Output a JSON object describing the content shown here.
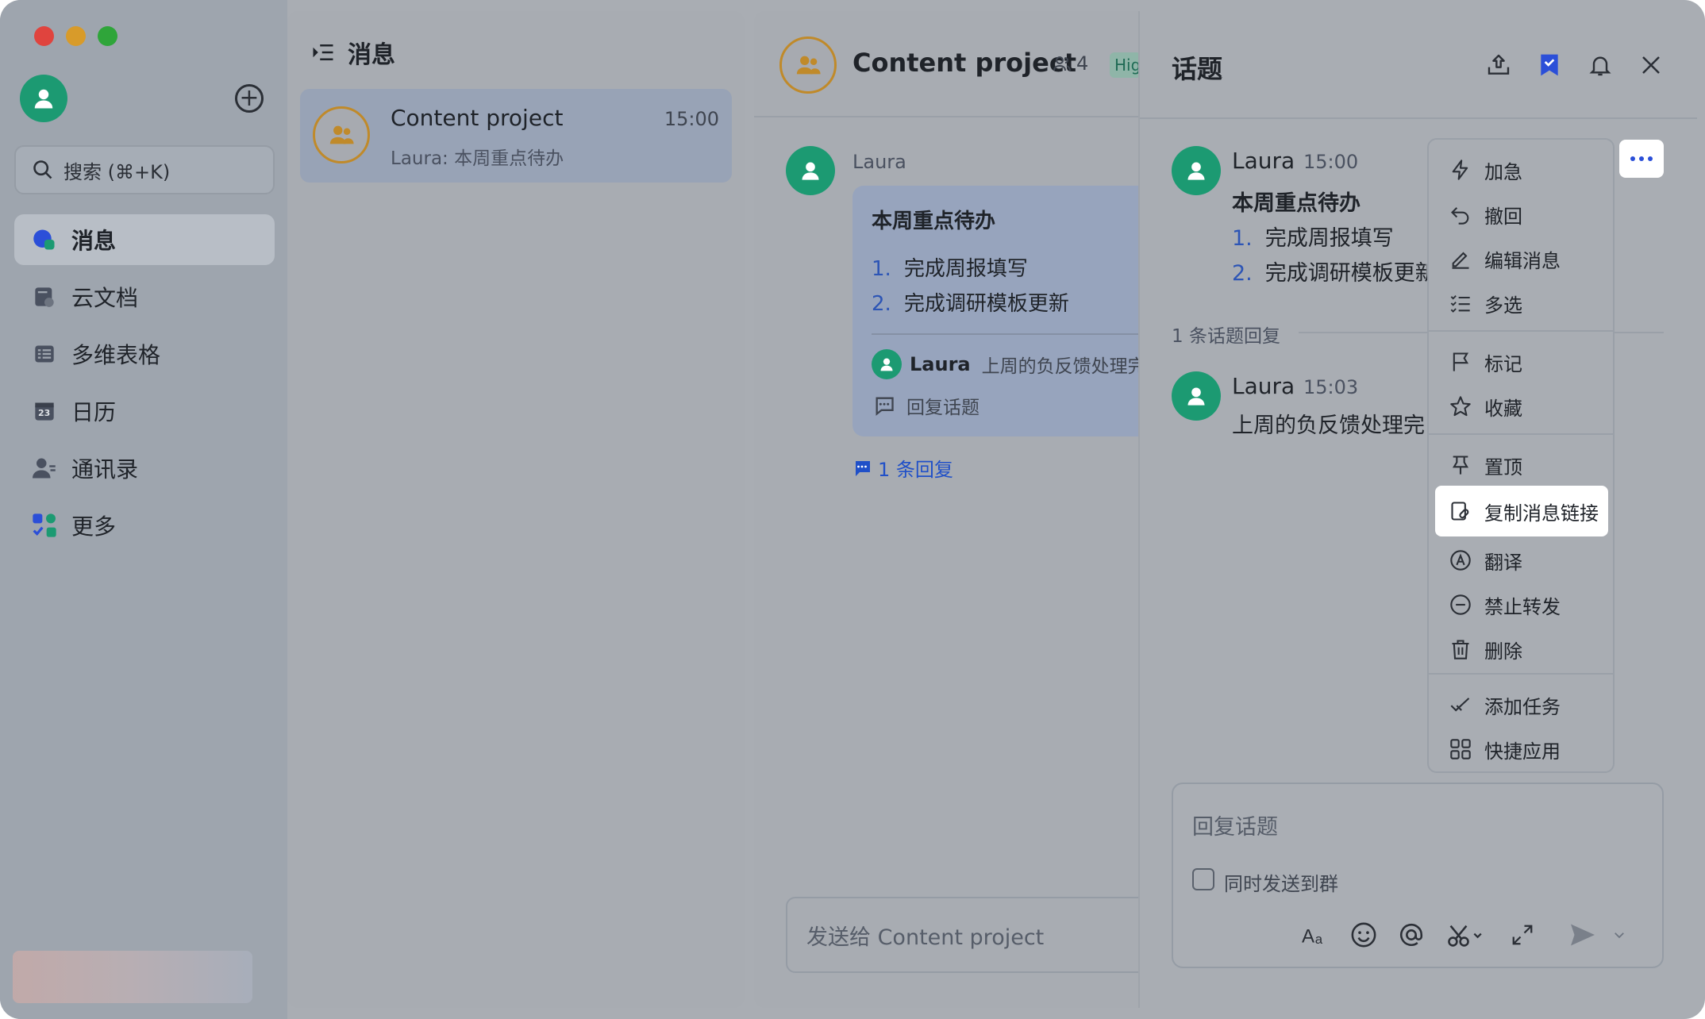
{
  "sidebar": {
    "search_placeholder": "搜索 (⌘+K)",
    "nav": [
      {
        "label": "消息",
        "icon": "message-icon",
        "active": true
      },
      {
        "label": "云文档",
        "icon": "docs-icon"
      },
      {
        "label": "多维表格",
        "icon": "base-icon"
      },
      {
        "label": "日历",
        "icon": "calendar-icon",
        "badge": "23"
      },
      {
        "label": "通讯录",
        "icon": "contacts-icon"
      },
      {
        "label": "更多",
        "icon": "apps-icon"
      }
    ]
  },
  "message_list": {
    "title": "消息",
    "conversations": [
      {
        "name": "Content project",
        "time": "15:00",
        "preview": "Laura: 本周重点待办"
      }
    ]
  },
  "chat": {
    "title": "Content project",
    "member_count": "4",
    "tag": "High",
    "message": {
      "sender": "Laura",
      "title": "本周重点待办",
      "items": [
        {
          "num": "1.",
          "text": "完成周报填写"
        },
        {
          "num": "2.",
          "text": "完成调研模板更新"
        }
      ],
      "latest_reply_name": "Laura",
      "latest_reply_text": "上周的负反馈处理完",
      "reply_topic_label": "回复话题",
      "reply_count_label": "1 条回复"
    },
    "input_placeholder": "发送给 Content project"
  },
  "thread": {
    "title": "话题",
    "root": {
      "name": "Laura",
      "time": "15:00",
      "title": "本周重点待办",
      "items": [
        {
          "num": "1.",
          "text": "完成周报填写"
        },
        {
          "num": "2.",
          "text": "完成调研模板更新"
        }
      ]
    },
    "replies_label": "1 条话题回复",
    "reply": {
      "name": "Laura",
      "time": "15:03",
      "text": "上周的负反馈处理完"
    },
    "input_placeholder": "回复话题",
    "also_send_label": "同时发送到群"
  },
  "context_menu": {
    "items": [
      {
        "label": "加急",
        "icon": "lightning-icon"
      },
      {
        "label": "撤回",
        "icon": "undo-icon"
      },
      {
        "label": "编辑消息",
        "icon": "edit-icon"
      },
      {
        "label": "多选",
        "icon": "multi-select-icon"
      },
      {
        "label": "标记",
        "icon": "flag-icon"
      },
      {
        "label": "收藏",
        "icon": "star-icon"
      },
      {
        "label": "置顶",
        "icon": "pin-icon"
      },
      {
        "label": "复制消息链接",
        "icon": "link-icon",
        "active": true
      },
      {
        "label": "翻译",
        "icon": "translate-icon"
      },
      {
        "label": "禁止转发",
        "icon": "no-forward-icon"
      },
      {
        "label": "删除",
        "icon": "trash-icon"
      },
      {
        "label": "添加任务",
        "icon": "task-icon"
      },
      {
        "label": "快捷应用",
        "icon": "quick-apps-icon"
      }
    ]
  },
  "colors": {
    "accent_blue": "#2b4fd8",
    "avatar_green": "#1c9a72",
    "group_ring": "#c08a2a"
  }
}
